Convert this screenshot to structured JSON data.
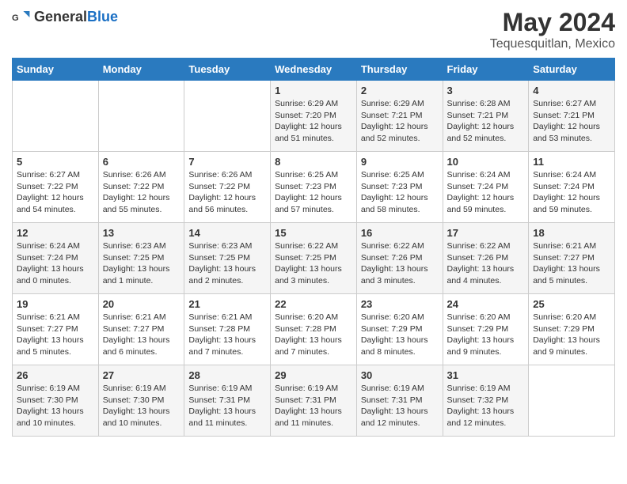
{
  "logo": {
    "general": "General",
    "blue": "Blue"
  },
  "title": "May 2024",
  "subtitle": "Tequesquitlan, Mexico",
  "days_of_week": [
    "Sunday",
    "Monday",
    "Tuesday",
    "Wednesday",
    "Thursday",
    "Friday",
    "Saturday"
  ],
  "weeks": [
    [
      {
        "day": "",
        "sunrise": "",
        "sunset": "",
        "daylight": ""
      },
      {
        "day": "",
        "sunrise": "",
        "sunset": "",
        "daylight": ""
      },
      {
        "day": "",
        "sunrise": "",
        "sunset": "",
        "daylight": ""
      },
      {
        "day": "1",
        "sunrise": "6:29 AM",
        "sunset": "7:20 PM",
        "daylight": "12 hours and 51 minutes."
      },
      {
        "day": "2",
        "sunrise": "6:29 AM",
        "sunset": "7:21 PM",
        "daylight": "12 hours and 52 minutes."
      },
      {
        "day": "3",
        "sunrise": "6:28 AM",
        "sunset": "7:21 PM",
        "daylight": "12 hours and 52 minutes."
      },
      {
        "day": "4",
        "sunrise": "6:27 AM",
        "sunset": "7:21 PM",
        "daylight": "12 hours and 53 minutes."
      }
    ],
    [
      {
        "day": "5",
        "sunrise": "6:27 AM",
        "sunset": "7:22 PM",
        "daylight": "12 hours and 54 minutes."
      },
      {
        "day": "6",
        "sunrise": "6:26 AM",
        "sunset": "7:22 PM",
        "daylight": "12 hours and 55 minutes."
      },
      {
        "day": "7",
        "sunrise": "6:26 AM",
        "sunset": "7:22 PM",
        "daylight": "12 hours and 56 minutes."
      },
      {
        "day": "8",
        "sunrise": "6:25 AM",
        "sunset": "7:23 PM",
        "daylight": "12 hours and 57 minutes."
      },
      {
        "day": "9",
        "sunrise": "6:25 AM",
        "sunset": "7:23 PM",
        "daylight": "12 hours and 58 minutes."
      },
      {
        "day": "10",
        "sunrise": "6:24 AM",
        "sunset": "7:24 PM",
        "daylight": "12 hours and 59 minutes."
      },
      {
        "day": "11",
        "sunrise": "6:24 AM",
        "sunset": "7:24 PM",
        "daylight": "12 hours and 59 minutes."
      }
    ],
    [
      {
        "day": "12",
        "sunrise": "6:24 AM",
        "sunset": "7:24 PM",
        "daylight": "13 hours and 0 minutes."
      },
      {
        "day": "13",
        "sunrise": "6:23 AM",
        "sunset": "7:25 PM",
        "daylight": "13 hours and 1 minute."
      },
      {
        "day": "14",
        "sunrise": "6:23 AM",
        "sunset": "7:25 PM",
        "daylight": "13 hours and 2 minutes."
      },
      {
        "day": "15",
        "sunrise": "6:22 AM",
        "sunset": "7:25 PM",
        "daylight": "13 hours and 3 minutes."
      },
      {
        "day": "16",
        "sunrise": "6:22 AM",
        "sunset": "7:26 PM",
        "daylight": "13 hours and 3 minutes."
      },
      {
        "day": "17",
        "sunrise": "6:22 AM",
        "sunset": "7:26 PM",
        "daylight": "13 hours and 4 minutes."
      },
      {
        "day": "18",
        "sunrise": "6:21 AM",
        "sunset": "7:27 PM",
        "daylight": "13 hours and 5 minutes."
      }
    ],
    [
      {
        "day": "19",
        "sunrise": "6:21 AM",
        "sunset": "7:27 PM",
        "daylight": "13 hours and 5 minutes."
      },
      {
        "day": "20",
        "sunrise": "6:21 AM",
        "sunset": "7:27 PM",
        "daylight": "13 hours and 6 minutes."
      },
      {
        "day": "21",
        "sunrise": "6:21 AM",
        "sunset": "7:28 PM",
        "daylight": "13 hours and 7 minutes."
      },
      {
        "day": "22",
        "sunrise": "6:20 AM",
        "sunset": "7:28 PM",
        "daylight": "13 hours and 7 minutes."
      },
      {
        "day": "23",
        "sunrise": "6:20 AM",
        "sunset": "7:29 PM",
        "daylight": "13 hours and 8 minutes."
      },
      {
        "day": "24",
        "sunrise": "6:20 AM",
        "sunset": "7:29 PM",
        "daylight": "13 hours and 9 minutes."
      },
      {
        "day": "25",
        "sunrise": "6:20 AM",
        "sunset": "7:29 PM",
        "daylight": "13 hours and 9 minutes."
      }
    ],
    [
      {
        "day": "26",
        "sunrise": "6:19 AM",
        "sunset": "7:30 PM",
        "daylight": "13 hours and 10 minutes."
      },
      {
        "day": "27",
        "sunrise": "6:19 AM",
        "sunset": "7:30 PM",
        "daylight": "13 hours and 10 minutes."
      },
      {
        "day": "28",
        "sunrise": "6:19 AM",
        "sunset": "7:31 PM",
        "daylight": "13 hours and 11 minutes."
      },
      {
        "day": "29",
        "sunrise": "6:19 AM",
        "sunset": "7:31 PM",
        "daylight": "13 hours and 11 minutes."
      },
      {
        "day": "30",
        "sunrise": "6:19 AM",
        "sunset": "7:31 PM",
        "daylight": "13 hours and 12 minutes."
      },
      {
        "day": "31",
        "sunrise": "6:19 AM",
        "sunset": "7:32 PM",
        "daylight": "13 hours and 12 minutes."
      },
      {
        "day": "",
        "sunrise": "",
        "sunset": "",
        "daylight": ""
      }
    ]
  ],
  "labels": {
    "sunrise_prefix": "Sunrise: ",
    "sunset_prefix": "Sunset: ",
    "daylight_prefix": "Daylight: "
  }
}
